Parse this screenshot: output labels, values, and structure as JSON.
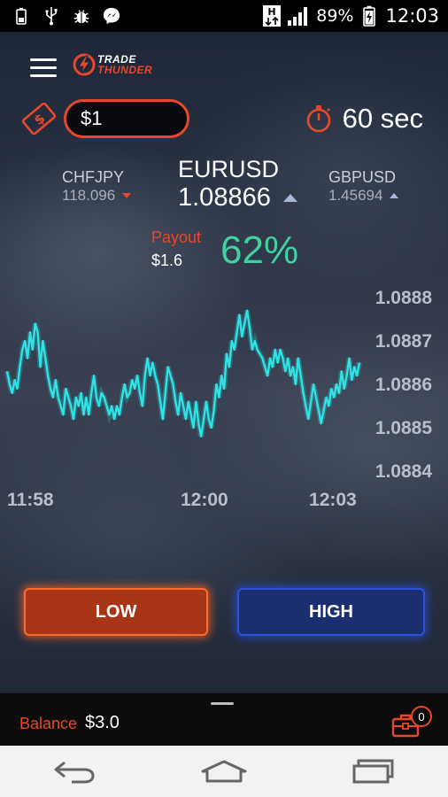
{
  "status_bar": {
    "icons_left": [
      "battery-icon",
      "usb-icon",
      "debug-icon",
      "messenger-icon"
    ],
    "icons_right": [
      "network-h-icon",
      "signal-icon",
      "battery-charging-icon"
    ],
    "battery_percent": "89%",
    "time": "12:03"
  },
  "header": {
    "logo_line1": "TRADE",
    "logo_line2": "THUNDER",
    "menu_icon": "hamburger-menu-icon"
  },
  "trade": {
    "amount": "$1",
    "amount_icon": "money-icon",
    "timer_icon": "stopwatch-icon",
    "expiry": "60 sec"
  },
  "pairs": {
    "left": {
      "name": "CHFJPY",
      "value": "118.096",
      "direction": "down"
    },
    "center": {
      "name": "EURUSD",
      "value": "1.08866",
      "direction": "up"
    },
    "right": {
      "name": "GBPUSD",
      "value": "1.45694",
      "direction": "up"
    }
  },
  "payout": {
    "label": "Payout",
    "amount": "$1.6",
    "percent": "62%"
  },
  "chart_data": {
    "type": "line",
    "x_tick_labels": [
      "11:58",
      "12:00",
      "12:03"
    ],
    "y_tick_labels": [
      "1.0888",
      "1.0887",
      "1.0886",
      "1.0885",
      "1.0884"
    ],
    "ylim": [
      1.0884,
      1.0888
    ],
    "line_color": "#2de3e6",
    "series": [
      {
        "values": [
          1.08863,
          1.0886,
          1.08858,
          1.08861,
          1.08859,
          1.08864,
          1.08868,
          1.0887,
          1.08866,
          1.08872,
          1.08868,
          1.08874,
          1.08872,
          1.08864,
          1.0887,
          1.08866,
          1.08862,
          1.08859,
          1.08857,
          1.08861,
          1.08857,
          1.08855,
          1.08853,
          1.08859,
          1.08857,
          1.08855,
          1.08852,
          1.08857,
          1.08855,
          1.08858,
          1.08853,
          1.08857,
          1.08853,
          1.08858,
          1.08862,
          1.08857,
          1.08855,
          1.08858,
          1.08857,
          1.08855,
          1.08853,
          1.08855,
          1.08852,
          1.08855,
          1.08853,
          1.08857,
          1.0886,
          1.08857,
          1.08858,
          1.08861,
          1.08859,
          1.08862,
          1.08858,
          1.08855,
          1.08862,
          1.08866,
          1.08862,
          1.08865,
          1.08862,
          1.0886,
          1.08856,
          1.08852,
          1.08858,
          1.08864,
          1.08862,
          1.0886,
          1.08856,
          1.08853,
          1.08858,
          1.08855,
          1.08852,
          1.08856,
          1.08853,
          1.0885,
          1.08856,
          1.08851,
          1.08848,
          1.08852,
          1.08856,
          1.08852,
          1.0885,
          1.08854,
          1.0886,
          1.08857,
          1.08862,
          1.08859,
          1.08867,
          1.08864,
          1.0887,
          1.08868,
          1.08872,
          1.08876,
          1.08871,
          1.08874,
          1.08877,
          1.08873,
          1.08868,
          1.0887,
          1.08868,
          1.08867,
          1.08866,
          1.08864,
          1.08862,
          1.08866,
          1.08864,
          1.08868,
          1.08865,
          1.08868,
          1.08866,
          1.08863,
          1.08866,
          1.08862,
          1.08864,
          1.0886,
          1.08866,
          1.08862,
          1.08858,
          1.08855,
          1.08852,
          1.08856,
          1.0886,
          1.08857,
          1.08854,
          1.08851,
          1.08854,
          1.08857,
          1.08855,
          1.08859,
          1.08857,
          1.0886,
          1.08858,
          1.08863,
          1.08859,
          1.08862,
          1.08866,
          1.08861,
          1.08864,
          1.08862,
          1.08865
        ]
      }
    ]
  },
  "actions": {
    "low_label": "LOW",
    "high_label": "HIGH"
  },
  "balance": {
    "label": "Balance",
    "value": "$3.0",
    "portfolio_count": "0"
  },
  "nav": {
    "icons": [
      "back-icon",
      "home-icon",
      "recent-apps-icon"
    ]
  }
}
